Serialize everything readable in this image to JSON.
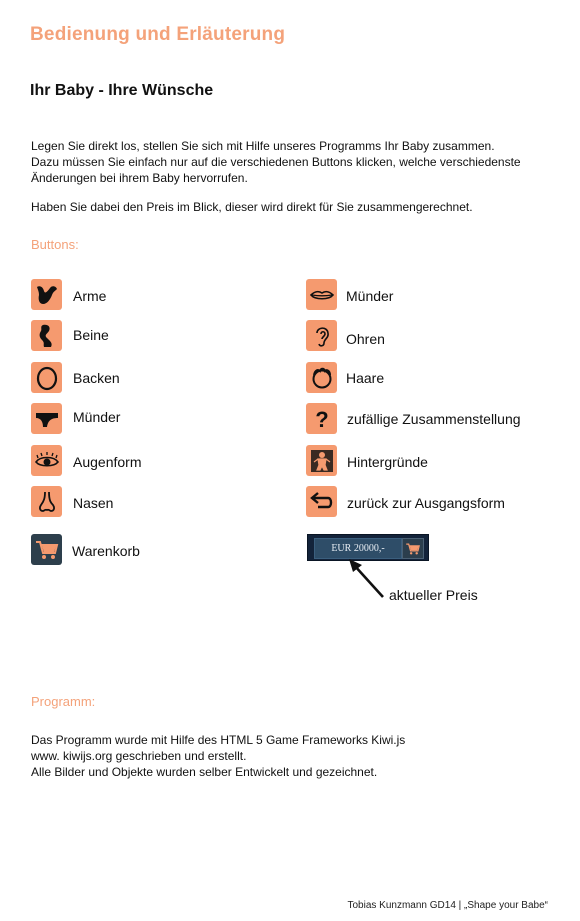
{
  "title": "Bedienung und Erläuterung",
  "subtitle": "Ihr Baby - Ihre Wünsche",
  "intro": [
    "Legen Sie direkt los, stellen Sie sich mit Hilfe unseres Programms Ihr Baby zusammen.",
    "Dazu müssen Sie einfach nur auf die verschiedenen Buttons klicken, welche verschiedenste",
    "Änderungen bei ihrem Baby hervorrufen."
  ],
  "price_note": "Haben Sie dabei den Preis im Blick, dieser wird direkt für Sie zusammengerechnet.",
  "buttons_heading": "Buttons:",
  "buttons_left": [
    {
      "label": "Arme",
      "icon": "arm-icon"
    },
    {
      "label": "Beine",
      "icon": "leg-icon"
    },
    {
      "label": "Backen",
      "icon": "face-outline-icon"
    },
    {
      "label": "Münder",
      "icon": "mouth-shape-icon"
    },
    {
      "label": "Augenform",
      "icon": "eye-icon"
    },
    {
      "label": "Nasen",
      "icon": "nose-icon"
    },
    {
      "label": "Warenkorb",
      "icon": "shopping-cart-icon"
    }
  ],
  "buttons_right": [
    {
      "label": "Münder",
      "icon": "lips-icon"
    },
    {
      "label": "Ohren",
      "icon": "ear-icon"
    },
    {
      "label": "Haare",
      "icon": "hair-icon"
    },
    {
      "label": "zufällige Zusammenstellung",
      "icon": "question-mark-icon"
    },
    {
      "label": "Hintergründe",
      "icon": "baby-figure-icon"
    },
    {
      "label": "zurück zur Ausgangsform",
      "icon": "undo-arrow-icon"
    }
  ],
  "price_display": {
    "value": "EUR 20000,-",
    "caption": "aktueller Preis"
  },
  "program_heading": "Programm:",
  "program_text": [
    "Das Programm wurde mit Hilfe des HTML 5 Game Frameworks Kiwi.js",
    "www. kiwijs.org geschrieben und erstellt.",
    "Alle Bilder und Objekte wurden selber Entwickelt und gezeichnet."
  ],
  "footer": "Tobias Kunzmann GD14  | „Shape your Babe“",
  "colors": {
    "accent": "#f4a27a",
    "icon_bg": "#f59a6f",
    "cart_bg": "#2d3f4c",
    "price_bar": "#13233a"
  }
}
